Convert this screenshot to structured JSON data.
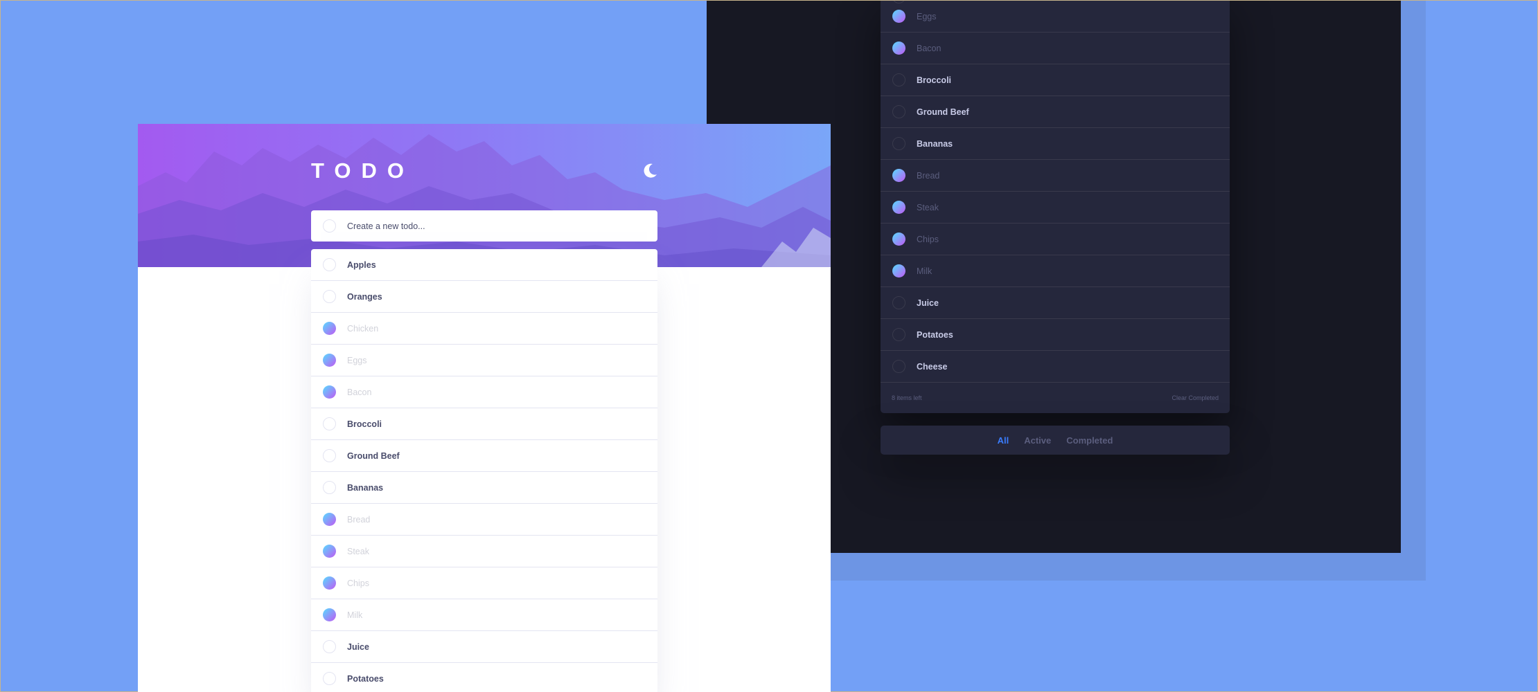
{
  "colors": {
    "background": "#73a0f6",
    "dark_bg": "#171823",
    "dark_card": "#25273c",
    "accent": "#3a7cfd",
    "check_gradient_start": "#55ddff",
    "check_gradient_end": "#c058f3"
  },
  "dark_app": {
    "items": [
      {
        "label": "",
        "done": false
      },
      {
        "label": "Eggs",
        "done": true
      },
      {
        "label": "Bacon",
        "done": true
      },
      {
        "label": "Broccoli",
        "done": false
      },
      {
        "label": "Ground Beef",
        "done": false
      },
      {
        "label": "Bananas",
        "done": false
      },
      {
        "label": "Bread",
        "done": true
      },
      {
        "label": "Steak",
        "done": true
      },
      {
        "label": "Chips",
        "done": true
      },
      {
        "label": "Milk",
        "done": true
      },
      {
        "label": "Juice",
        "done": false
      },
      {
        "label": "Potatoes",
        "done": false
      },
      {
        "label": "Cheese",
        "done": false
      }
    ],
    "footer": {
      "items_left": "8 items left",
      "clear_completed": "Clear Completed"
    },
    "filters": {
      "all": "All",
      "active": "Active",
      "completed": "Completed"
    }
  },
  "light_app": {
    "title": "TODO",
    "theme_toggle_icon": "moon-icon",
    "new_todo": {
      "placeholder": "Create a new todo..."
    },
    "items": [
      {
        "label": "Apples",
        "done": false
      },
      {
        "label": "Oranges",
        "done": false
      },
      {
        "label": "Chicken",
        "done": true
      },
      {
        "label": "Eggs",
        "done": true
      },
      {
        "label": "Bacon",
        "done": true
      },
      {
        "label": "Broccoli",
        "done": false
      },
      {
        "label": "Ground Beef",
        "done": false
      },
      {
        "label": "Bananas",
        "done": false
      },
      {
        "label": "Bread",
        "done": true
      },
      {
        "label": "Steak",
        "done": true
      },
      {
        "label": "Chips",
        "done": true
      },
      {
        "label": "Milk",
        "done": true
      },
      {
        "label": "Juice",
        "done": false
      },
      {
        "label": "Potatoes",
        "done": false
      }
    ]
  }
}
